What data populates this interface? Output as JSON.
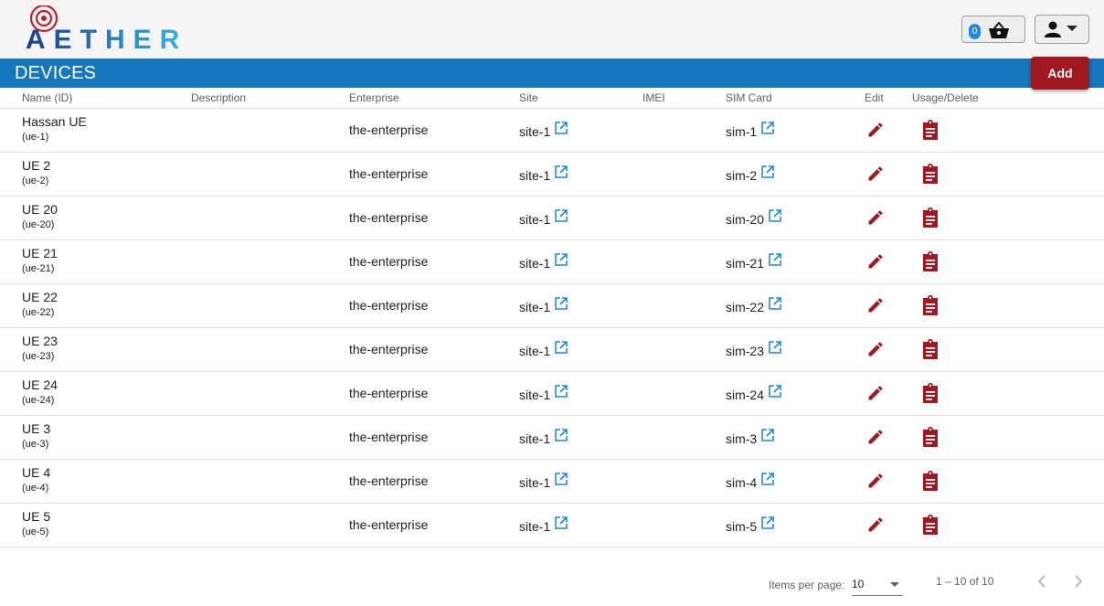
{
  "header": {
    "logo_text": "AETHER",
    "cart_count": "0",
    "cart_icon": "basket-icon",
    "user_icon": "person-icon"
  },
  "titlebar": {
    "title": "DEVICES",
    "add_label": "Add"
  },
  "table": {
    "columns": [
      "Name (ID)",
      "Description",
      "Enterprise",
      "Site",
      "IMEI",
      "SIM Card",
      "Edit",
      "Usage/Delete"
    ],
    "rows": [
      {
        "name": "Hassan UE",
        "id": "(ue-1)",
        "description": "",
        "enterprise": "the-enterprise",
        "site": "site-1",
        "imei": "",
        "sim": "sim-1"
      },
      {
        "name": "UE 2",
        "id": "(ue-2)",
        "description": "",
        "enterprise": "the-enterprise",
        "site": "site-1",
        "imei": "",
        "sim": "sim-2"
      },
      {
        "name": "UE 20",
        "id": "(ue-20)",
        "description": "",
        "enterprise": "the-enterprise",
        "site": "site-1",
        "imei": "",
        "sim": "sim-20"
      },
      {
        "name": "UE 21",
        "id": "(ue-21)",
        "description": "",
        "enterprise": "the-enterprise",
        "site": "site-1",
        "imei": "",
        "sim": "sim-21"
      },
      {
        "name": "UE 22",
        "id": "(ue-22)",
        "description": "",
        "enterprise": "the-enterprise",
        "site": "site-1",
        "imei": "",
        "sim": "sim-22"
      },
      {
        "name": "UE 23",
        "id": "(ue-23)",
        "description": "",
        "enterprise": "the-enterprise",
        "site": "site-1",
        "imei": "",
        "sim": "sim-23"
      },
      {
        "name": "UE 24",
        "id": "(ue-24)",
        "description": "",
        "enterprise": "the-enterprise",
        "site": "site-1",
        "imei": "",
        "sim": "sim-24"
      },
      {
        "name": "UE 3",
        "id": "(ue-3)",
        "description": "",
        "enterprise": "the-enterprise",
        "site": "site-1",
        "imei": "",
        "sim": "sim-3"
      },
      {
        "name": "UE 4",
        "id": "(ue-4)",
        "description": "",
        "enterprise": "the-enterprise",
        "site": "site-1",
        "imei": "",
        "sim": "sim-4"
      },
      {
        "name": "UE 5",
        "id": "(ue-5)",
        "description": "",
        "enterprise": "the-enterprise",
        "site": "site-1",
        "imei": "",
        "sim": "sim-5"
      }
    ]
  },
  "paginator": {
    "items_per_page_label": "Items per page:",
    "items_per_page": "10",
    "range": "1 – 10 of 10"
  },
  "colors": {
    "titlebar": "#1677bd",
    "accent_red": "#a01820",
    "link_blue": "#1e88e5"
  }
}
